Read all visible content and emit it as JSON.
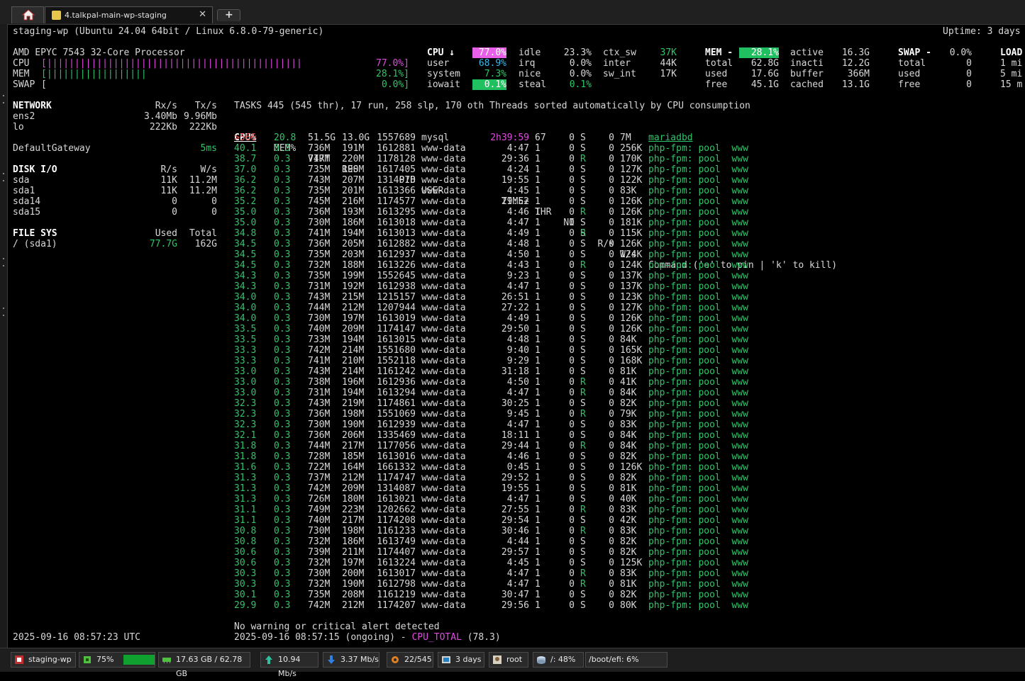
{
  "tabs": {
    "home_icon": "home-icon",
    "active_title": "4.talkpal-main-wp-staging",
    "close_glyph": "✕",
    "new_tab_glyph": "+"
  },
  "header": {
    "host_line": "staging-wp (Ubuntu 24.04 64bit / Linux 6.8.0-79-generic)",
    "uptime": "Uptime: 3 days"
  },
  "quicklook": {
    "cpu_name": "AMD EPYC 7543 32-Core Processor",
    "cpu_label": "CPU",
    "cpu_bar": "[||||||||||||||||||||||||||||||||||||||||||||||",
    "cpu_pct": "77.0%]",
    "mem_label": "MEM",
    "mem_bar": "[||||||||||||||||||",
    "mem_pct": "28.1%]",
    "swap_label": "SWAP",
    "swap_bar": "[",
    "swap_pct": "0.0%]"
  },
  "cpu": {
    "title": "CPU ↓",
    "total": "77.0%",
    "user_l": "user",
    "user": "68.9%",
    "system_l": "system",
    "system": "7.3%",
    "iowait_l": "iowait",
    "iowait": "0.1%",
    "idle_l": "idle",
    "idle": "23.3%",
    "irq_l": "irq",
    "irq": "0.0%",
    "nice_l": "nice",
    "nice": "0.0%",
    "steal_l": "steal",
    "steal": "0.1%",
    "ctx_sw_l": "ctx_sw",
    "ctx_sw": "37K",
    "inter_l": "inter",
    "inter": "44K",
    "sw_int_l": "sw_int",
    "sw_int": "17K"
  },
  "mem": {
    "title": "MEM -",
    "total_pct": "28.1%",
    "total_l": "total",
    "total": "62.8G",
    "used_l": "used",
    "used": "17.6G",
    "free_l": "free",
    "free": "45.1G",
    "active_l": "active",
    "active": "16.3G",
    "inacti_l": "inacti",
    "inacti": "12.2G",
    "buffer_l": "buffer",
    "buffer": "366M",
    "cached_l": "cached",
    "cached": "13.1G"
  },
  "swap": {
    "title": "SWAP -",
    "pct": "0.0%",
    "total_l": "total",
    "total": "0",
    "used_l": "used",
    "used": "0",
    "free_l": "free",
    "free": "0"
  },
  "load": {
    "title": "LOAD",
    "l1": "1 mi",
    "l5": "5 mi",
    "l15": "15 m"
  },
  "network": {
    "title": "NETWORK",
    "rx_h": "Rx/s",
    "tx_h": "Tx/s",
    "rows": [
      {
        "name": "ens2",
        "rx": "3.40Mb",
        "tx": "9.96Mb"
      },
      {
        "name": "lo",
        "rx": "222Kb",
        "tx": "222Kb"
      }
    ],
    "gateway_l": "DefaultGateway",
    "gateway": "5ms"
  },
  "disk": {
    "title": "DISK I/O",
    "r_h": "R/s",
    "w_h": "W/s",
    "rows": [
      {
        "name": "sda",
        "r": "11K",
        "w": "11.2M"
      },
      {
        "name": "sda1",
        "r": "11K",
        "w": "11.2M"
      },
      {
        "name": "sda14",
        "r": "0",
        "w": "0"
      },
      {
        "name": "sda15",
        "r": "0",
        "w": "0"
      }
    ]
  },
  "fs": {
    "title": "FILE SYS",
    "used_h": "Used",
    "total_h": "Total",
    "name": "/ (sda1)",
    "used": "77.7G",
    "total": "162G"
  },
  "tasks": {
    "summary": "TASKS 445 (545 thr), 17 run, 258 slp, 170 oth Threads sorted automatically by CPU consumption"
  },
  "columns": {
    "cpu": "CPU%",
    "mem": "MEM%",
    "virt": "VIRT",
    "res": "RES",
    "pid": "PID",
    "user": "USER",
    "time": "TIME+",
    "thr": "THR",
    "ni": "NI",
    "s": "S",
    "rs": "R/s",
    "ws": "W/s",
    "cmd": "Command ('e' to pin | 'k' to kill)"
  },
  "top_process": {
    "cpu": ">566",
    "mem": "20.8",
    "virt": "51.5G",
    "res": "13.0G",
    "pid": "1557689",
    "user": "mysql",
    "time": "2h39:59",
    "thr": "67",
    "ni": "0",
    "s": "S",
    "rs": "0",
    "ws": "7M",
    "cmd": "mariadbd"
  },
  "process_cmd": {
    "prog": "php-fpm:",
    "pool": "pool",
    "name": "www"
  },
  "processes": [
    [
      "40.1",
      "0.3",
      "736M",
      "191M",
      "1612881",
      "www-data",
      "4:47",
      "1",
      "0",
      "S",
      "0",
      "256K"
    ],
    [
      "38.7",
      "0.3",
      "747M",
      "220M",
      "1178128",
      "www-data",
      "29:36",
      "1",
      "0",
      "R",
      "0",
      "170K"
    ],
    [
      "37.0",
      "0.3",
      "735M",
      "190M",
      "1617405",
      "www-data",
      "4:24",
      "1",
      "0",
      "S",
      "0",
      "127K"
    ],
    [
      "36.2",
      "0.3",
      "743M",
      "207M",
      "1314078",
      "www-data",
      "19:55",
      "1",
      "0",
      "S",
      "0",
      "122K"
    ],
    [
      "36.2",
      "0.3",
      "735M",
      "201M",
      "1613366",
      "www-data",
      "4:45",
      "1",
      "0",
      "S",
      "0",
      "83K"
    ],
    [
      "35.2",
      "0.3",
      "745M",
      "216M",
      "1174577",
      "www-data",
      "29:52",
      "1",
      "0",
      "S",
      "0",
      "126K"
    ],
    [
      "35.0",
      "0.3",
      "736M",
      "193M",
      "1613295",
      "www-data",
      "4:46",
      "1",
      "0",
      "R",
      "0",
      "126K"
    ],
    [
      "35.0",
      "0.3",
      "730M",
      "186M",
      "1613018",
      "www-data",
      "4:47",
      "1",
      "0",
      "S",
      "0",
      "181K"
    ],
    [
      "34.8",
      "0.3",
      "741M",
      "194M",
      "1613013",
      "www-data",
      "4:49",
      "1",
      "0",
      "R",
      "0",
      "115K"
    ],
    [
      "34.5",
      "0.3",
      "736M",
      "205M",
      "1612882",
      "www-data",
      "4:48",
      "1",
      "0",
      "S",
      "0",
      "126K"
    ],
    [
      "34.5",
      "0.3",
      "735M",
      "203M",
      "1612937",
      "www-data",
      "4:50",
      "1",
      "0",
      "S",
      "0",
      "124K"
    ],
    [
      "34.5",
      "0.3",
      "732M",
      "188M",
      "1613226",
      "www-data",
      "4:43",
      "1",
      "0",
      "R",
      "0",
      "124K"
    ],
    [
      "34.3",
      "0.3",
      "735M",
      "199M",
      "1552645",
      "www-data",
      "9:23",
      "1",
      "0",
      "S",
      "0",
      "137K"
    ],
    [
      "34.3",
      "0.3",
      "731M",
      "192M",
      "1612938",
      "www-data",
      "4:47",
      "1",
      "0",
      "S",
      "0",
      "137K"
    ],
    [
      "34.0",
      "0.3",
      "743M",
      "215M",
      "1215157",
      "www-data",
      "26:51",
      "1",
      "0",
      "S",
      "0",
      "123K"
    ],
    [
      "34.0",
      "0.3",
      "744M",
      "212M",
      "1207944",
      "www-data",
      "27:22",
      "1",
      "0",
      "S",
      "0",
      "127K"
    ],
    [
      "34.0",
      "0.3",
      "730M",
      "197M",
      "1613019",
      "www-data",
      "4:49",
      "1",
      "0",
      "S",
      "0",
      "126K"
    ],
    [
      "33.5",
      "0.3",
      "740M",
      "209M",
      "1174147",
      "www-data",
      "29:50",
      "1",
      "0",
      "S",
      "0",
      "126K"
    ],
    [
      "33.5",
      "0.3",
      "733M",
      "194M",
      "1613015",
      "www-data",
      "4:48",
      "1",
      "0",
      "S",
      "0",
      "84K"
    ],
    [
      "33.3",
      "0.3",
      "742M",
      "214M",
      "1551680",
      "www-data",
      "9:40",
      "1",
      "0",
      "S",
      "0",
      "165K"
    ],
    [
      "33.3",
      "0.3",
      "741M",
      "210M",
      "1552118",
      "www-data",
      "9:29",
      "1",
      "0",
      "S",
      "0",
      "168K"
    ],
    [
      "33.0",
      "0.3",
      "743M",
      "214M",
      "1161242",
      "www-data",
      "31:18",
      "1",
      "0",
      "S",
      "0",
      "81K"
    ],
    [
      "33.0",
      "0.3",
      "738M",
      "196M",
      "1612936",
      "www-data",
      "4:50",
      "1",
      "0",
      "R",
      "0",
      "41K"
    ],
    [
      "33.0",
      "0.3",
      "731M",
      "194M",
      "1613294",
      "www-data",
      "4:47",
      "1",
      "0",
      "R",
      "0",
      "84K"
    ],
    [
      "32.3",
      "0.3",
      "743M",
      "219M",
      "1174861",
      "www-data",
      "30:25",
      "1",
      "0",
      "S",
      "0",
      "82K"
    ],
    [
      "32.3",
      "0.3",
      "736M",
      "198M",
      "1551069",
      "www-data",
      "9:45",
      "1",
      "0",
      "R",
      "0",
      "79K"
    ],
    [
      "32.3",
      "0.3",
      "730M",
      "190M",
      "1612939",
      "www-data",
      "4:47",
      "1",
      "0",
      "S",
      "0",
      "83K"
    ],
    [
      "32.1",
      "0.3",
      "736M",
      "206M",
      "1335469",
      "www-data",
      "18:11",
      "1",
      "0",
      "S",
      "0",
      "84K"
    ],
    [
      "31.8",
      "0.3",
      "744M",
      "217M",
      "1177056",
      "www-data",
      "29:44",
      "1",
      "0",
      "R",
      "0",
      "84K"
    ],
    [
      "31.8",
      "0.3",
      "728M",
      "185M",
      "1613016",
      "www-data",
      "4:46",
      "1",
      "0",
      "S",
      "0",
      "82K"
    ],
    [
      "31.6",
      "0.3",
      "722M",
      "164M",
      "1661332",
      "www-data",
      "0:45",
      "1",
      "0",
      "S",
      "0",
      "126K"
    ],
    [
      "31.3",
      "0.3",
      "737M",
      "212M",
      "1174747",
      "www-data",
      "29:52",
      "1",
      "0",
      "S",
      "0",
      "82K"
    ],
    [
      "31.3",
      "0.3",
      "742M",
      "209M",
      "1314087",
      "www-data",
      "19:55",
      "1",
      "0",
      "S",
      "0",
      "81K"
    ],
    [
      "31.3",
      "0.3",
      "726M",
      "180M",
      "1613021",
      "www-data",
      "4:47",
      "1",
      "0",
      "S",
      "0",
      "40K"
    ],
    [
      "31.1",
      "0.3",
      "749M",
      "223M",
      "1202662",
      "www-data",
      "27:55",
      "1",
      "0",
      "R",
      "0",
      "83K"
    ],
    [
      "31.1",
      "0.3",
      "740M",
      "217M",
      "1174208",
      "www-data",
      "29:54",
      "1",
      "0",
      "S",
      "0",
      "42K"
    ],
    [
      "30.8",
      "0.3",
      "730M",
      "198M",
      "1161233",
      "www-data",
      "30:46",
      "1",
      "0",
      "R",
      "0",
      "83K"
    ],
    [
      "30.8",
      "0.3",
      "732M",
      "186M",
      "1613749",
      "www-data",
      "4:44",
      "1",
      "0",
      "S",
      "0",
      "82K"
    ],
    [
      "30.6",
      "0.3",
      "739M",
      "211M",
      "1174407",
      "www-data",
      "29:57",
      "1",
      "0",
      "S",
      "0",
      "82K"
    ],
    [
      "30.6",
      "0.3",
      "732M",
      "197M",
      "1613224",
      "www-data",
      "4:45",
      "1",
      "0",
      "S",
      "0",
      "125K"
    ],
    [
      "30.3",
      "0.3",
      "730M",
      "200M",
      "1613017",
      "www-data",
      "4:47",
      "1",
      "0",
      "R",
      "0",
      "83K"
    ],
    [
      "30.3",
      "0.3",
      "732M",
      "190M",
      "1612798",
      "www-data",
      "4:47",
      "1",
      "0",
      "R",
      "0",
      "81K"
    ],
    [
      "30.1",
      "0.3",
      "735M",
      "208M",
      "1161219",
      "www-data",
      "30:47",
      "1",
      "0",
      "S",
      "0",
      "82K"
    ],
    [
      "29.9",
      "0.3",
      "742M",
      "212M",
      "1174207",
      "www-data",
      "29:56",
      "1",
      "0",
      "S",
      "0",
      "80K"
    ]
  ],
  "alerts": {
    "no_alert": "No warning or critical alert detected",
    "event_prefix": "2025-09-16 08:57:15 (ongoing) - ",
    "event_type": "CPU_TOTAL",
    "event_value": " (78.3)"
  },
  "clock": "2025-09-16 08:57:23 UTC",
  "statusbar": {
    "host": "staging-wp",
    "cpu": "75%",
    "mem": "17.63 GB / 62.78 GB",
    "upload": "10.94 Mb/s",
    "download": "3.37 Mb/s",
    "procs": "22/545",
    "uptime": "3 days",
    "user": "root",
    "disk_root": "/: 48%",
    "disk_efi": "/boot/efi: 6%"
  }
}
